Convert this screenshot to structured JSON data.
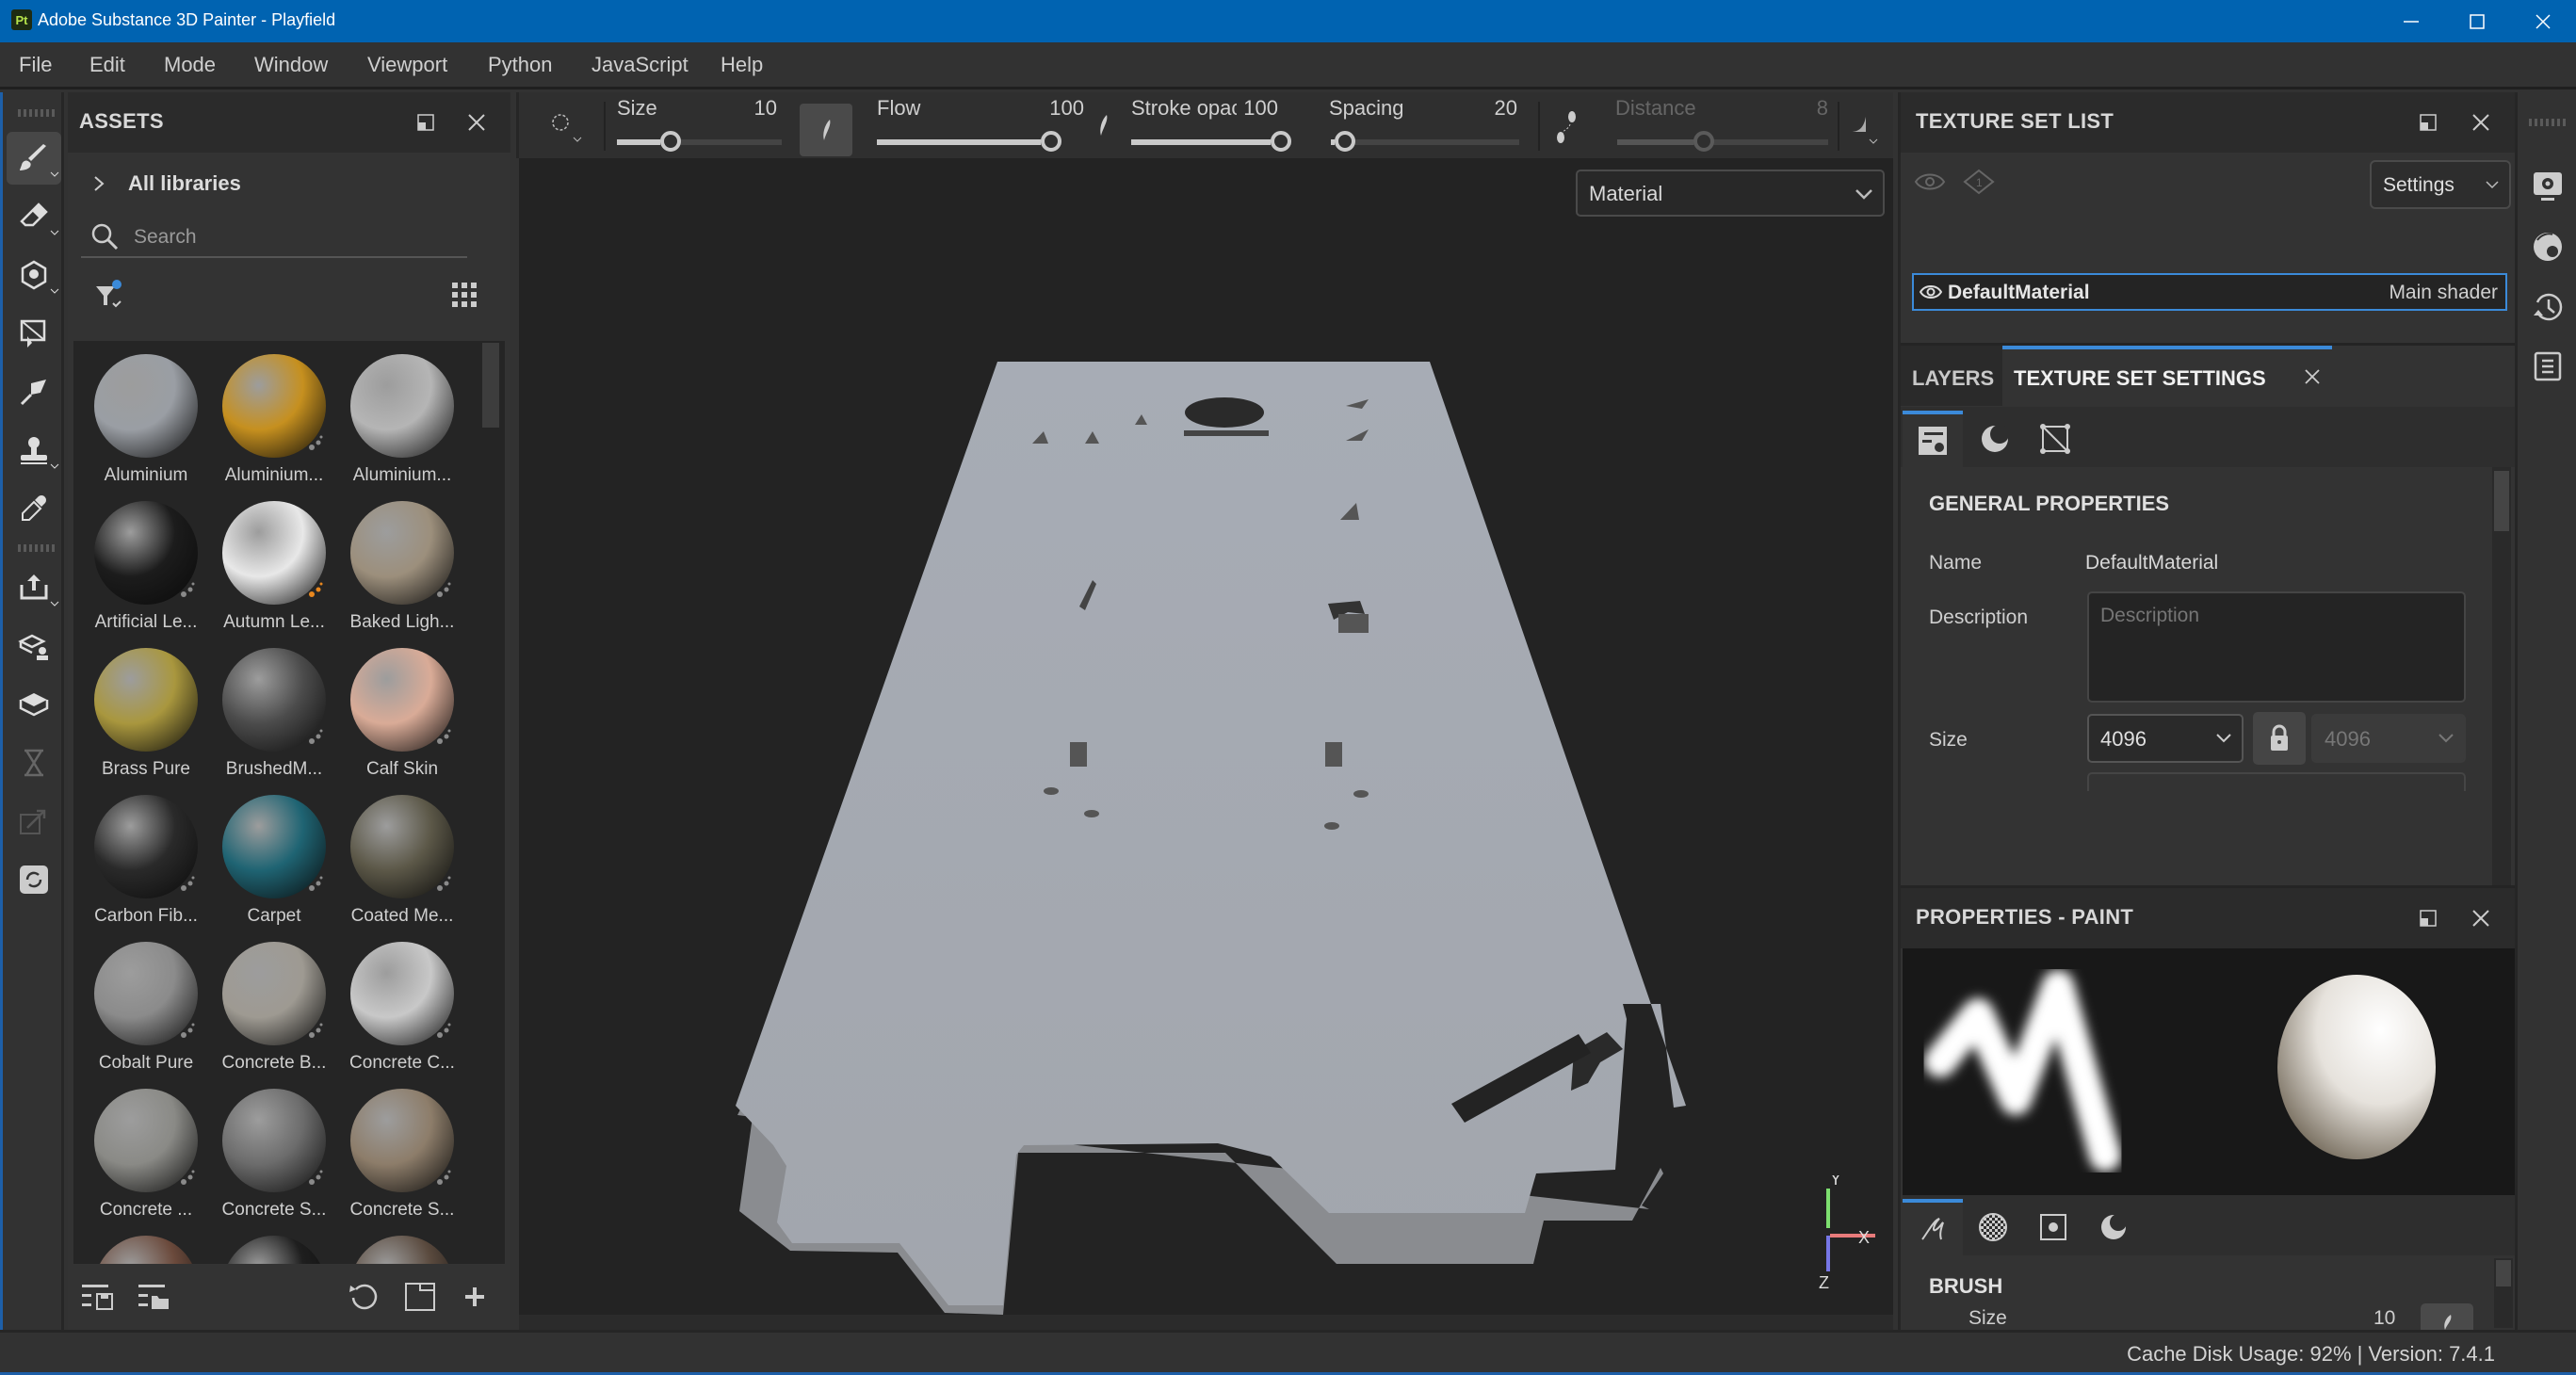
{
  "window": {
    "app_icon": "Pt",
    "title": "Adobe Substance 3D Painter - Playfield",
    "controls": [
      "minimize-icon",
      "maximize-icon",
      "close-icon"
    ]
  },
  "menu": [
    "File",
    "Edit",
    "Mode",
    "Window",
    "Viewport",
    "Python",
    "JavaScript",
    "Help"
  ],
  "left_toolbar": {
    "tools": [
      {
        "name": "paint-brush",
        "icon": "brush-icon",
        "active": true,
        "has_menu": true
      },
      {
        "name": "eraser",
        "icon": "eraser-icon",
        "has_menu": true
      },
      {
        "name": "projection",
        "icon": "projection-cube-icon",
        "has_menu": true
      },
      {
        "name": "polygon-fill",
        "icon": "polygon-fill-icon"
      },
      {
        "name": "smudge",
        "icon": "smudge-icon"
      },
      {
        "name": "clone",
        "icon": "clone-stamp-icon",
        "has_menu": true
      },
      {
        "name": "color-picker",
        "icon": "eyedropper-icon"
      },
      {
        "name": "export",
        "icon": "export-icon",
        "has_menu": true
      },
      {
        "name": "bake-mesh-maps",
        "icon": "bake-icon"
      },
      {
        "name": "display-settings",
        "icon": "mesh-icon"
      },
      {
        "name": "timeline",
        "icon": "hourglass-icon",
        "disabled": true
      },
      {
        "name": "resize",
        "icon": "resize-icon",
        "disabled": true
      },
      {
        "name": "sync",
        "icon": "sync-icon"
      }
    ]
  },
  "assets": {
    "title": "ASSETS",
    "library": "All libraries",
    "search_placeholder": "Search",
    "items": [
      {
        "label": "Aluminium",
        "color": "#9a9ea4"
      },
      {
        "label": "Aluminium...",
        "color": "#c6901f"
      },
      {
        "label": "Aluminium...",
        "color": "#b5b5b5"
      },
      {
        "label": "Artificial Le...",
        "color": "#1c1c1c"
      },
      {
        "label": "Autumn Le...",
        "color": "#e8e8e8"
      },
      {
        "label": "Baked Ligh...",
        "color": "#9c8f7c"
      },
      {
        "label": "Brass Pure",
        "color": "#a9973e"
      },
      {
        "label": "BrushedM...",
        "color": "#4c4c4c"
      },
      {
        "label": "Calf Skin",
        "color": "#d9ab97"
      },
      {
        "label": "Carbon Fib...",
        "color": "#2a2a2a"
      },
      {
        "label": "Carpet",
        "color": "#1f6473"
      },
      {
        "label": "Coated Me...",
        "color": "#5c5848"
      },
      {
        "label": "Cobalt Pure",
        "color": "#8b8b8b"
      },
      {
        "label": "Concrete B...",
        "color": "#9e9a92"
      },
      {
        "label": "Concrete C...",
        "color": "#c8c8c8"
      },
      {
        "label": "Concrete ...",
        "color": "#8a8a86"
      },
      {
        "label": "Concrete S...",
        "color": "#6c6c6c"
      },
      {
        "label": "Concrete S...",
        "color": "#8d7d6a"
      },
      {
        "label": "",
        "color": "#6b4a3c"
      },
      {
        "label": "",
        "color": "#1e1e1e"
      },
      {
        "label": "",
        "color": "#5a4a3e"
      }
    ],
    "footer": [
      "save-library-icon",
      "open-library-icon",
      "refresh-icon",
      "new-window-icon",
      "add-icon"
    ]
  },
  "viewport_toolbar": {
    "size": {
      "label": "Size",
      "value": "10",
      "fraction": 0.3
    },
    "flow": {
      "label": "Flow",
      "value": "100",
      "fraction": 1.0
    },
    "stroke_opacity": {
      "label": "Stroke opac",
      "value": "100",
      "fraction": 1.0
    },
    "spacing": {
      "label": "Spacing",
      "value": "20",
      "fraction": 0.02
    },
    "distance": {
      "label": "Distance",
      "value": "8",
      "fraction": 0.4,
      "disabled": true
    }
  },
  "viewport": {
    "display_mode": "Material",
    "axes": {
      "x": "X",
      "y": "Y",
      "z": "Z"
    },
    "axis_colors": {
      "x": "#e87b7b",
      "y": "#7ddf6f",
      "z": "#7676e6"
    }
  },
  "texture_set_list": {
    "title": "TEXTURE SET LIST",
    "settings_label": "Settings",
    "rows": [
      {
        "name": "DefaultMaterial",
        "shader": "Main shader"
      }
    ]
  },
  "tabs": [
    {
      "label": "LAYERS",
      "active": false
    },
    {
      "label": "TEXTURE SET SETTINGS",
      "active": true
    }
  ],
  "texture_set_settings": {
    "section": "GENERAL PROPERTIES",
    "name_label": "Name",
    "name_value": "DefaultMaterial",
    "description_label": "Description",
    "description_placeholder": "Description",
    "size_label": "Size",
    "size_width": "4096",
    "size_height": "4096"
  },
  "properties_paint": {
    "title": "PROPERTIES - PAINT",
    "section": "BRUSH",
    "group_label": "Size",
    "size_label": "Size",
    "size_value": "10"
  },
  "far_right_toolbar": [
    "display-settings-icon",
    "shader-settings-icon",
    "history-icon",
    "log-icon"
  ],
  "status": {
    "text": "Cache Disk Usage: 92% | Version: 7.4.1"
  },
  "colors": {
    "accent": "#3b8ad9",
    "titlebar": "#0063b1"
  }
}
